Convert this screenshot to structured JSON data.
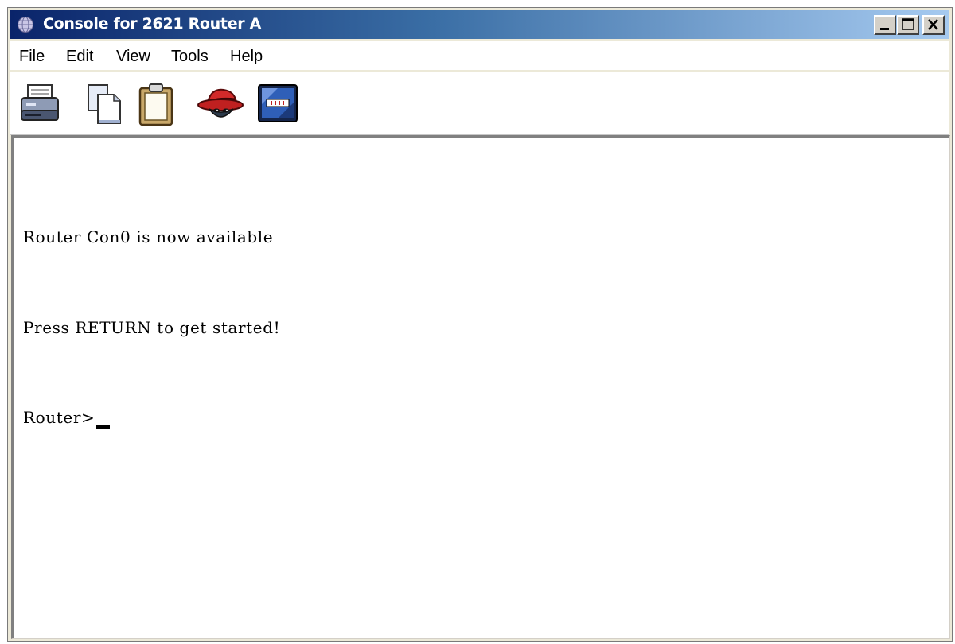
{
  "window": {
    "title": "Console for 2621 Router A",
    "controls": [
      "minimize",
      "maximize",
      "close"
    ]
  },
  "menubar": {
    "items": [
      "File",
      "Edit",
      "View",
      "Tools",
      "Help"
    ]
  },
  "toolbar": {
    "icons": [
      "print-icon",
      "copy-icon",
      "paste-icon",
      "spy-hat-icon",
      "connect-icon"
    ]
  },
  "terminal": {
    "lines": [
      "Router Con0 is now available",
      "Press RETURN to get started!",
      "Router>"
    ]
  },
  "colors": {
    "titlebar_start": "#0a246a",
    "titlebar_end": "#a6caf0",
    "terminal_background": "#ffffff",
    "terminal_text": "#000000"
  }
}
